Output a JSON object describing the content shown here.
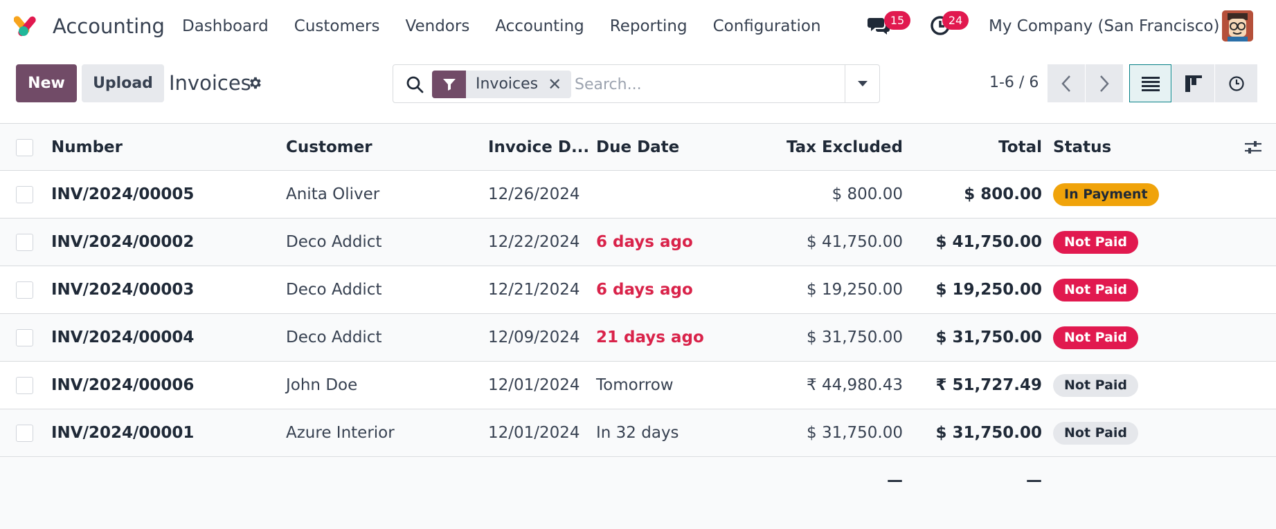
{
  "navbar": {
    "app_name": "Accounting",
    "menu": [
      "Dashboard",
      "Customers",
      "Vendors",
      "Accounting",
      "Reporting",
      "Configuration"
    ],
    "messages_count": "15",
    "activities_count": "24",
    "company": "My Company (San Francisco)"
  },
  "control": {
    "new_label": "New",
    "upload_label": "Upload",
    "title": "Invoices",
    "facet_label": "Invoices",
    "facet_remove": "✕",
    "search_placeholder": "Search...",
    "pager": "1-6 / 6"
  },
  "table": {
    "columns": [
      "Number",
      "Customer",
      "Invoice D...",
      "Due Date",
      "Tax Excluded",
      "Total",
      "Status"
    ],
    "rows": [
      {
        "number": "INV/2024/00005",
        "customer": "Anita Oliver",
        "invoice_date": "12/26/2024",
        "due_date": "",
        "tax_excluded": "$ 800.00",
        "total": "$ 800.00",
        "status": "In Payment"
      },
      {
        "number": "INV/2024/00002",
        "customer": "Deco Addict",
        "invoice_date": "12/22/2024",
        "due_date": "6 days ago",
        "tax_excluded": "$ 41,750.00",
        "total": "$ 41,750.00",
        "status": "Not Paid"
      },
      {
        "number": "INV/2024/00003",
        "customer": "Deco Addict",
        "invoice_date": "12/21/2024",
        "due_date": "6 days ago",
        "tax_excluded": "$ 19,250.00",
        "total": "$ 19,250.00",
        "status": "Not Paid"
      },
      {
        "number": "INV/2024/00004",
        "customer": "Deco Addict",
        "invoice_date": "12/09/2024",
        "due_date": "21 days ago",
        "tax_excluded": "$ 31,750.00",
        "total": "$ 31,750.00",
        "status": "Not Paid"
      },
      {
        "number": "INV/2024/00006",
        "customer": "John Doe",
        "invoice_date": "12/01/2024",
        "due_date": "Tomorrow",
        "tax_excluded": "₹ 44,980.43",
        "total": "₹ 51,727.49",
        "status": "Not Paid"
      },
      {
        "number": "INV/2024/00001",
        "customer": "Azure Interior",
        "invoice_date": "12/01/2024",
        "due_date": "In 32 days",
        "tax_excluded": "$ 31,750.00",
        "total": "$ 31,750.00",
        "status": "Not Paid"
      }
    ],
    "totals": {
      "tax_excluded": "—",
      "total": "—"
    }
  },
  "colors": {
    "brand": "#714b67",
    "overdue": "#d9234a",
    "in_payment": "#f0a30a",
    "not_paid_danger": "#e1194f",
    "not_paid_neutral": "#e5e7eb",
    "active_view": "#017e84"
  }
}
